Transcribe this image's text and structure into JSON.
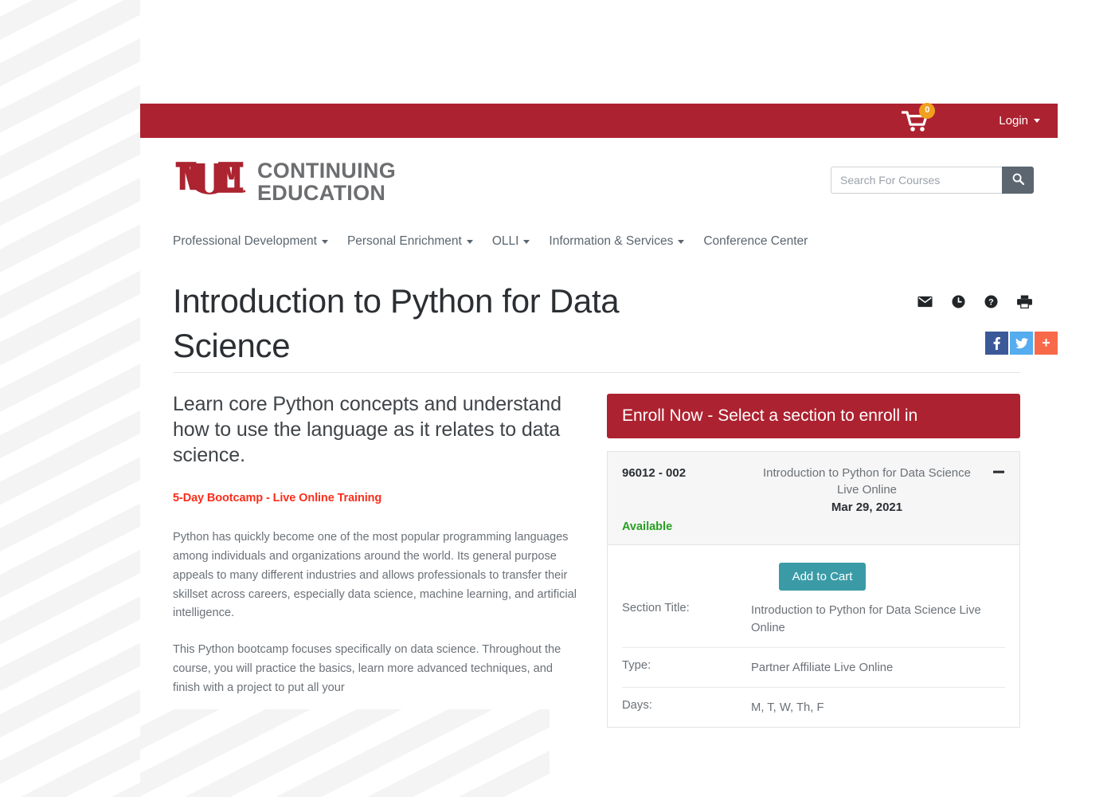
{
  "top_bar": {
    "cart_icon": "shopping-cart-icon",
    "cart_count": "0",
    "login_label": "Login"
  },
  "header": {
    "logo_mark": "unm-lobos-logo",
    "brand_line1": "CONTINUING",
    "brand_line2": "EDUCATION",
    "search": {
      "placeholder": "Search For Courses",
      "value": "",
      "button_icon": "search-icon"
    }
  },
  "nav": {
    "items": [
      {
        "label": "Professional Development",
        "has_dropdown": true
      },
      {
        "label": "Personal Enrichment",
        "has_dropdown": true
      },
      {
        "label": "OLLI",
        "has_dropdown": true
      },
      {
        "label": "Information & Services",
        "has_dropdown": true
      },
      {
        "label": "Conference Center",
        "has_dropdown": false
      }
    ]
  },
  "page": {
    "title": "Introduction to Python for Data Science",
    "action_icons": [
      "envelope-icon",
      "clock-icon",
      "question-circle-icon",
      "printer-icon"
    ],
    "social_buttons": [
      {
        "name": "facebook-share-button",
        "glyph": "f",
        "color": "#3b5998"
      },
      {
        "name": "twitter-share-button",
        "glyph": "✦",
        "color": "#55acee"
      },
      {
        "name": "more-share-button",
        "glyph": "+",
        "color": "#f8694a"
      }
    ]
  },
  "content": {
    "lead": "Learn core Python concepts and understand how to use the language as it relates to data science.",
    "bootcamp_tag": "5-Day Bootcamp - Live Online Training",
    "paragraph_1": "Python has quickly become one of the most popular programming languages among individuals and organizations around the world. Its general purpose appeals to many different industries and allows professionals to transfer their skillset across careers, especially data science, machine learning, and artificial intelligence.",
    "paragraph_2": "This Python bootcamp focuses specifically on data science. Throughout the course, you will practice the basics, learn more advanced techniques, and finish with a project to put all your"
  },
  "enroll": {
    "header_label": "Enroll Now - Select a section to enroll in",
    "section": {
      "code": "96012 - 002",
      "title": "Introduction to Python for Data Science Live Online",
      "date": "Mar 29, 2021",
      "status": "Available",
      "collapse_icon": "minus-icon",
      "add_to_cart_label": "Add to Cart",
      "details": [
        {
          "label": "Section Title:",
          "value": "Introduction to Python for Data Science Live Online"
        },
        {
          "label": "Type:",
          "value": "Partner Affiliate Live Online"
        },
        {
          "label": "Days:",
          "value": "M, T, W, Th, F"
        }
      ]
    }
  },
  "colors": {
    "brand_red": "#ad2230",
    "accent_teal": "#3a9ba6",
    "status_green": "#27a022",
    "tag_red": "#fb2d1b",
    "badge_orange": "#f0a01e"
  }
}
